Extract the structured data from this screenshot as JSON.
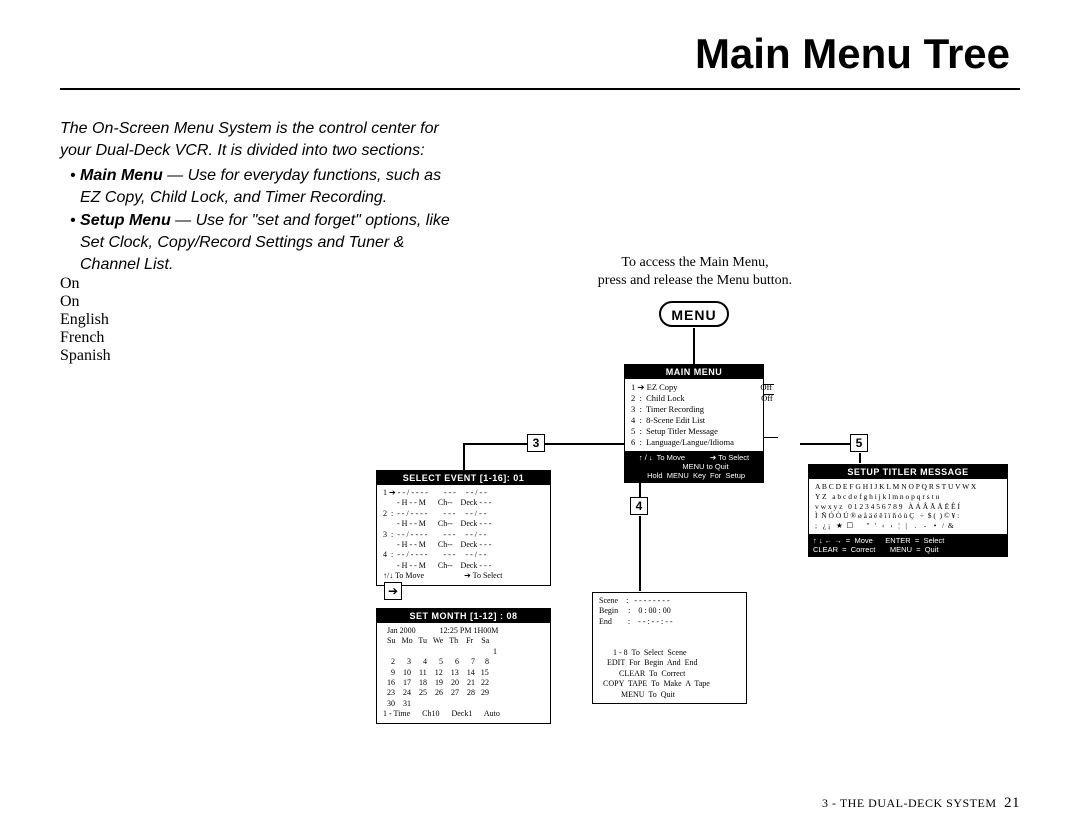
{
  "title": "Main Menu Tree",
  "intro": {
    "lead": "The On-Screen Menu System is the control center for your Dual-Deck VCR. It is divided into two sections:",
    "bullet1_label": "Main Menu",
    "bullet1_text": " — Use for everyday functions, such as EZ Copy, Child Lock, and Timer Recording.",
    "bullet2_label": "Setup Menu",
    "bullet2_text": " — Use for \"set and forget\" options, like Set Clock, Copy/Record Settings and Tuner & Channel List."
  },
  "access_text": "To access the Main Menu,\npress and release the Menu button.",
  "menu_label": "MENU",
  "numbers": {
    "three": "3",
    "four": "4",
    "five": "5"
  },
  "main_menu": {
    "header": "MAIN MENU",
    "body": "1 ➔ EZ Copy                                       Off\n2  :  Child Lock                                    Off\n3  :  Timer Recording\n4  :  8-Scene Edit List\n5  :  Setup Titler Message\n6  :  Language/Langue/Idioma",
    "foot": "↑ / ↓  To Move            ➔ To Select\n           MENU to Quit\n  Hold  MENU  Key  For  Setup",
    "side_on": "On\nOn",
    "side_lang": "English\nFrench\nSpanish"
  },
  "select_event": {
    "header": "SELECT EVENT [1-16]: 01",
    "body": "1 ➔ - - / - - - -        - - -     - - / - -\n       - H - - M      Ch--    Deck - - -\n2  :  - - / - - - -        - - -     - - / - -\n       - H - - M      Ch--    Deck - - -\n3  :  - - / - - - -        - - -     - - / - -\n       - H - - M      Ch--    Deck - - -\n4  :  - - / - - - -        - - -     - - / - -\n       - H - - M      Ch--    Deck - - -\n↑/↓ To Move                    ➔ To Select",
    "arrow_label": "➔"
  },
  "set_month": {
    "header": "SET MONTH [1-12] : 08",
    "body": "  Jan 2000            12:25 PM 1H00M\n  Su   Mo   Tu   We   Th    Fr    Sa\n                                                       1\n    2      3      4      5      6      7     8\n    9    10    11    12    13    14   15\n  16    17    18    19    20    21   22\n  23    24    25    26    27    28   29\n  30    31\n1 - Time      Ch10      Deck1      Auto"
  },
  "scene_edit": {
    "body": "Scene    :   - - - - - - - -\nBegin     :    0 : 00 : 00\nEnd        :    - - : - - : - -\n\n\n       1 - 8  To  Select  Scene\n    EDIT  For  Begin  And  End\n          CLEAR  To  Correct\n  COPY  TAPE  To  Make  A  Tape\n           MENU  To  Quit"
  },
  "titler": {
    "header": "SETUP TITLER MESSAGE",
    "body": "A B C D E F G H I J K L M N O P Q R S T U V W X\nY Z   a b c d e f g h i j k l m n o p q r s t u\nv w x y z   0 1 2 3 4 5 6 7 8 9   À Á Â Ã Ä Ë Ê Í\nÌ  Ñ Ó Ò Ú ® ø å ä ë ê î ï ñ ó ù Ç   ÷  $ (  ) © ¥ :\n;   ¿ ¡   ★  ☐       \"   '   ‹   ›   ¦   |    .    -    •   /  &",
    "foot": "↑ ↓ ← →  =  Move      ENTER  =  Select\nCLEAR  =  Correct       MENU  =  Quit"
  },
  "footer": {
    "section": "3 - THE DUAL-DECK SYSTEM",
    "page": "21"
  }
}
